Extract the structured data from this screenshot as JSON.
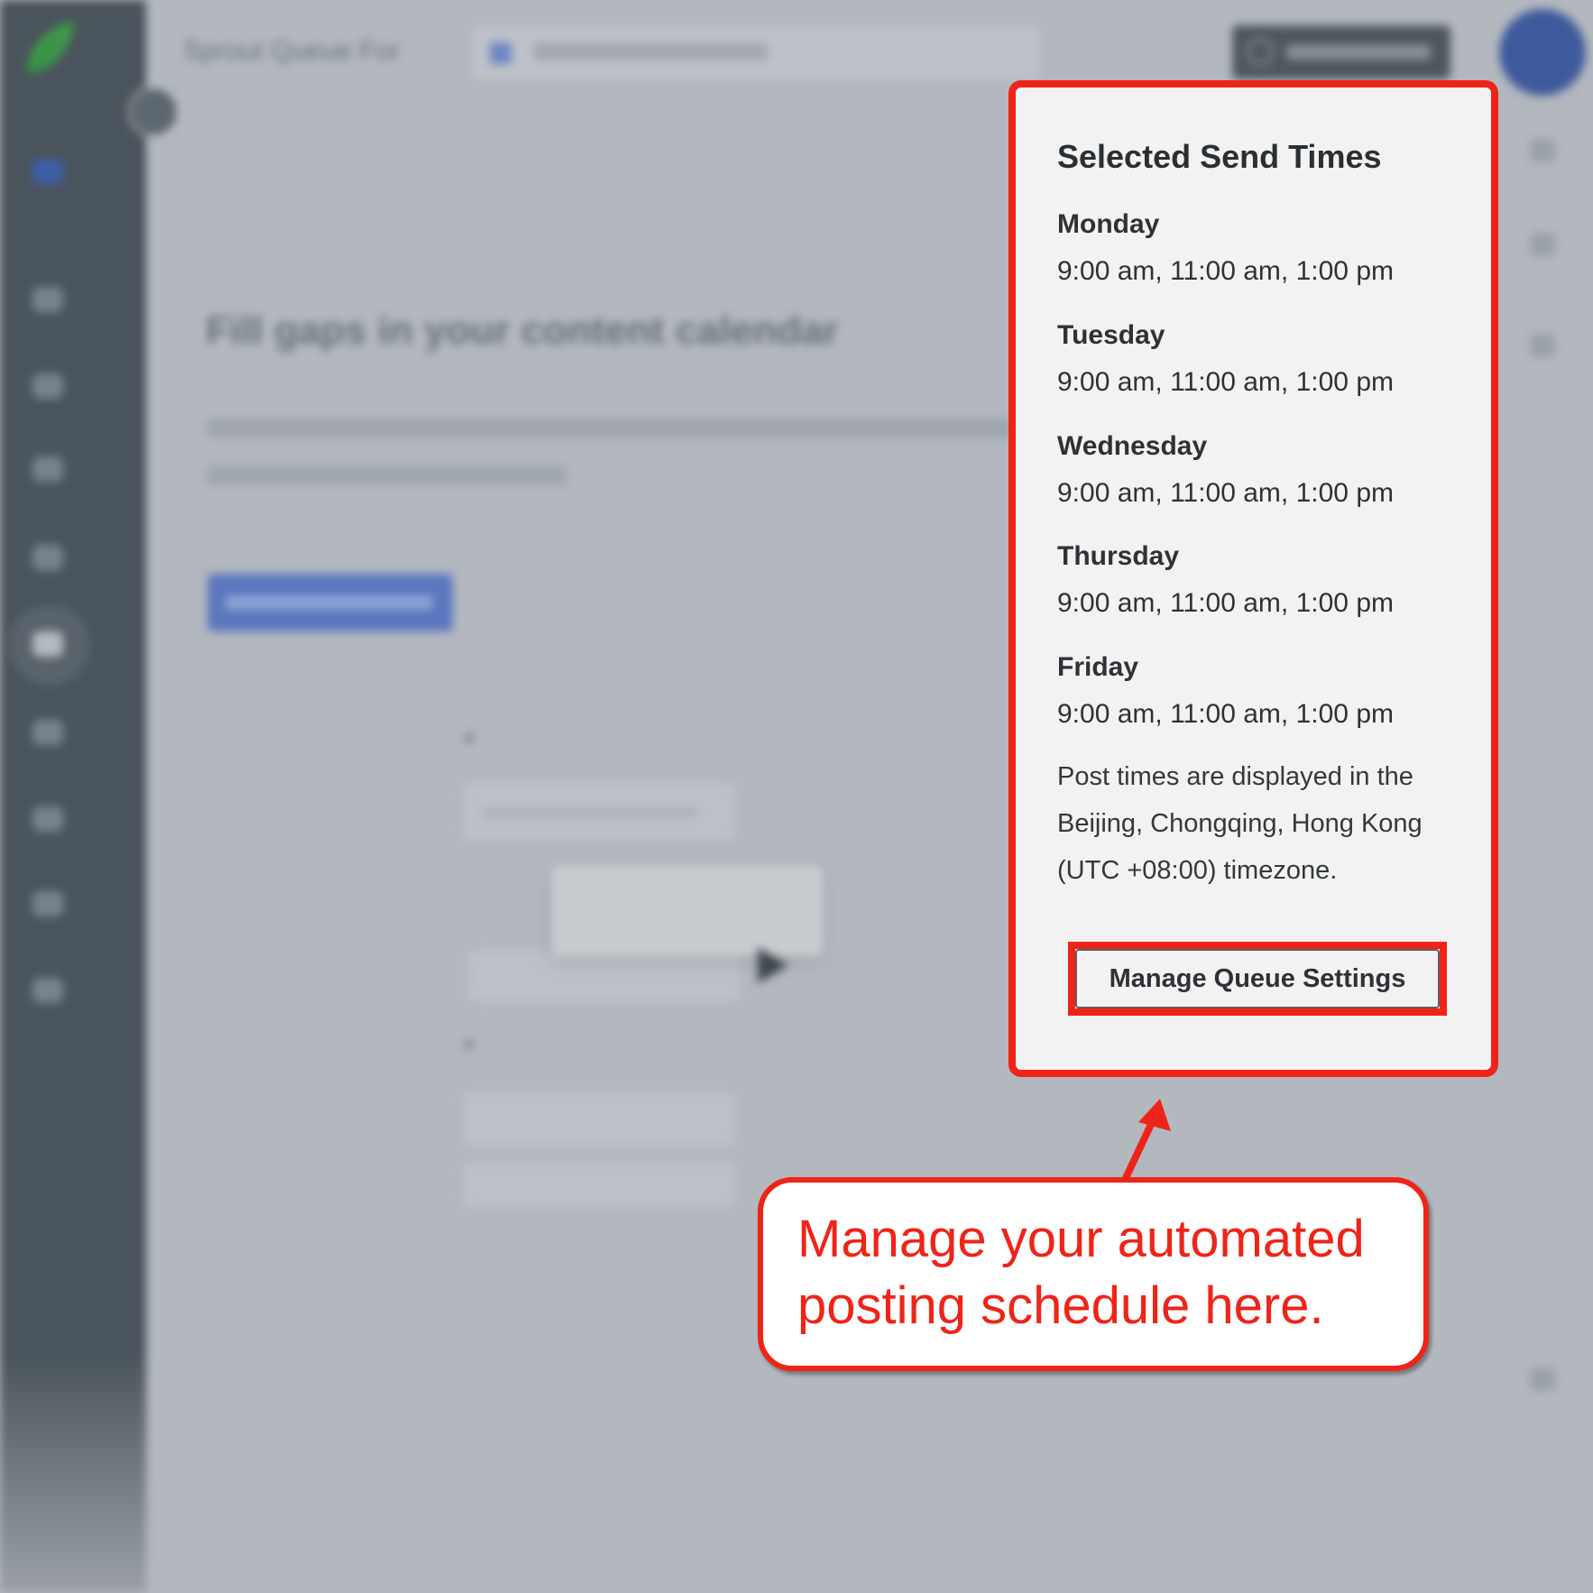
{
  "topbar": {
    "title": "Sprout Queue For"
  },
  "hero": {
    "title": "Fill gaps in your content calendar"
  },
  "popover": {
    "title": "Selected Send Times",
    "days": [
      {
        "day": "Monday",
        "times": "9:00 am, 11:00 am, 1:00 pm"
      },
      {
        "day": "Tuesday",
        "times": "9:00 am, 11:00 am, 1:00 pm"
      },
      {
        "day": "Wednesday",
        "times": "9:00 am, 11:00 am, 1:00 pm"
      },
      {
        "day": "Thursday",
        "times": "9:00 am, 11:00 am, 1:00 pm"
      },
      {
        "day": "Friday",
        "times": "9:00 am, 11:00 am, 1:00 pm"
      }
    ],
    "timezone_note": "Post times are displayed in the Beijing, Chongqing, Hong Kong (UTC +08:00) timezone.",
    "manage_button": "Manage Queue Settings"
  },
  "callout": {
    "text": "Manage your automated posting schedule here."
  },
  "colors": {
    "highlight_red": "#ef2418",
    "popover_bg": "#f2f2f2",
    "sidebar_bg": "#4a545c",
    "accent_blue": "#3e5a9c"
  },
  "icons": {
    "logo": "sprout-leaf-icon",
    "compose": "compose-icon",
    "queue_times": "clock-icon"
  }
}
